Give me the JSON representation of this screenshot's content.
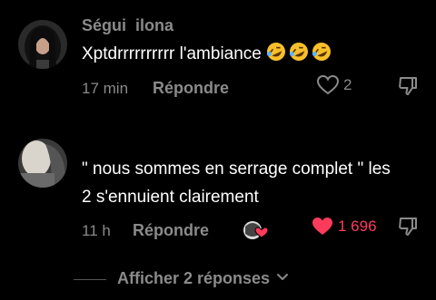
{
  "comments": [
    {
      "author": "Ségui  ilona",
      "text": "Xptdrrrrrrrrrr l'ambiance",
      "emoji": "rolling-on-floor-laughing-emoji x3",
      "time": "17 min",
      "reply_label": "Répondre",
      "likes": "2",
      "liked": false
    },
    {
      "author": "",
      "text_line1": "\" nous sommes en serrage complet \" les",
      "text_line2": "2 s'ennuient clairement",
      "time": "11 h",
      "reply_label": "Répondre",
      "likes": "1 696",
      "liked": true,
      "creator_liked_badge": "creator-avatar-heart"
    }
  ],
  "show_more_label": "Afficher 2 réponses",
  "colors": {
    "background": "#000000",
    "text": "#ffffff",
    "muted": "#8a8a8a",
    "like_red": "#ff3b5c"
  }
}
